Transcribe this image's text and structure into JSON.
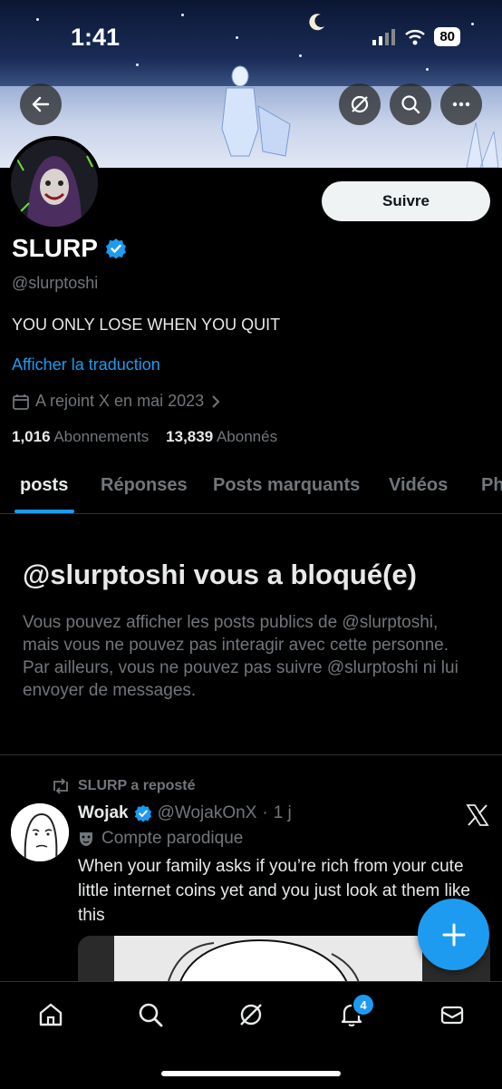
{
  "status_bar": {
    "time": "1:41",
    "battery": "80"
  },
  "profile": {
    "name": "SLURP",
    "handle": "@slurptoshi",
    "bio": "YOU ONLY LOSE WHEN YOU QUIT",
    "translate_link": "Afficher la traduction",
    "joined": "A rejoint X en mai 2023",
    "following_count": "1,016",
    "following_label": "Abonnements",
    "followers_count": "13,839",
    "followers_label": "Abonnés",
    "follow_button": "Suivre"
  },
  "tabs": [
    "posts",
    "Réponses",
    "Posts marquants",
    "Vidéos",
    "Ph"
  ],
  "blocked": {
    "title": "@slurptoshi vous a bloqué(e)",
    "text": "Vous pouvez afficher les posts publics de @slurptoshi, mais vous ne pouvez pas interagir avec cette personne. Par ailleurs, vous ne pouvez pas suivre @slurptoshi ni lui envoyer de messages."
  },
  "post": {
    "repost_label": "SLURP a reposté",
    "author_name": "Wojak",
    "author_handle": "@WojakOnX",
    "separator": "·",
    "age": "1 j",
    "parody_label": "Compte parodique",
    "text": "When your family asks if you’re rich from your cute little internet coins yet and you just look at them like this"
  },
  "nav": {
    "notifications_badge": "4"
  },
  "colors": {
    "accent": "#1d9bf0",
    "background": "#000000",
    "muted": "#71767b"
  }
}
